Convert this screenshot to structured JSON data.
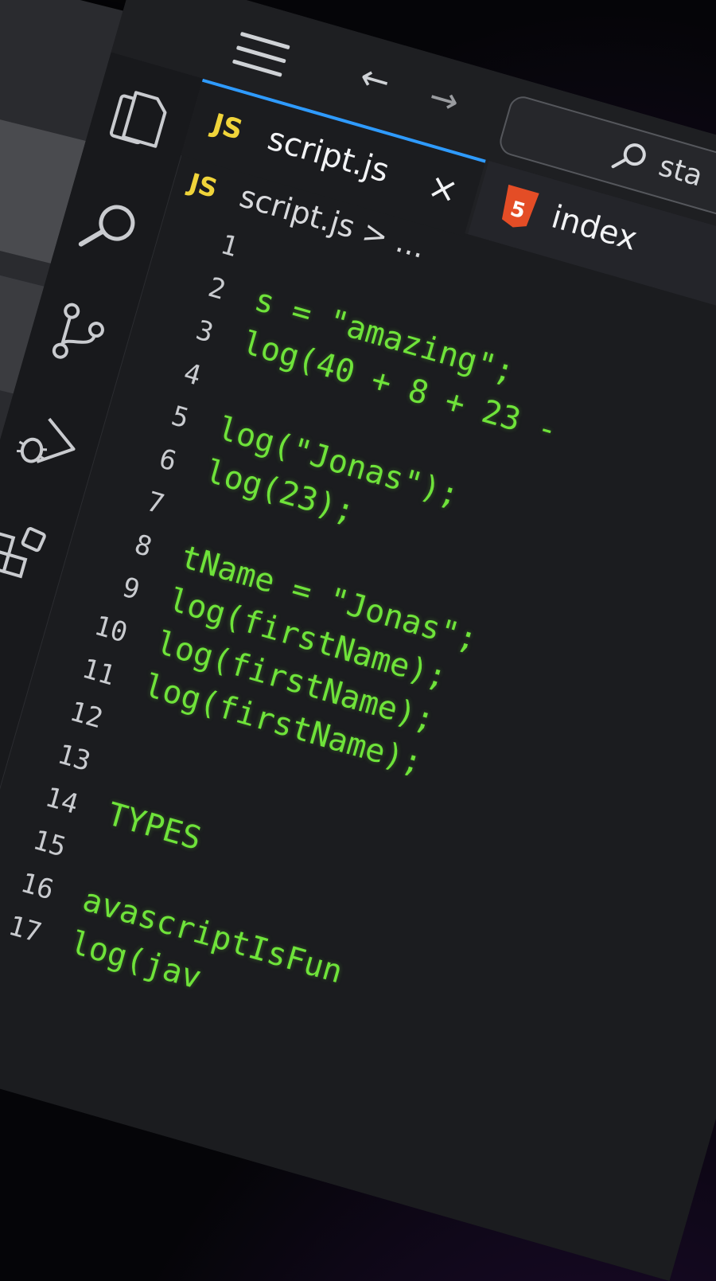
{
  "titlebar": {
    "back_arrow": "←",
    "forward_arrow": "→",
    "search_text": "sta"
  },
  "tabs": [
    {
      "icon": "JS",
      "label": "script.js",
      "close": "×"
    },
    {
      "icon": "html5-icon",
      "label": "index"
    }
  ],
  "breadcrumb": {
    "icon": "JS",
    "path": "script.js > ..."
  },
  "activity_bar": [
    "files-icon",
    "search-icon",
    "source-control-icon",
    "run-debug-icon",
    "extensions-icon"
  ],
  "code": [
    {
      "n": "1",
      "text": ""
    },
    {
      "n": "2",
      "text": "s = \"amazing\";"
    },
    {
      "n": "3",
      "text": "log(40 + 8 + 23 -"
    },
    {
      "n": "4",
      "text": ""
    },
    {
      "n": "5",
      "text": "log(\"Jonas\");"
    },
    {
      "n": "6",
      "text": "log(23);"
    },
    {
      "n": "7",
      "text": ""
    },
    {
      "n": "8",
      "text": "tName = \"Jonas\";"
    },
    {
      "n": "9",
      "text": "log(firstName);"
    },
    {
      "n": "10",
      "text": "log(firstName);"
    },
    {
      "n": "11",
      "text": "log(firstName);"
    },
    {
      "n": "12",
      "text": ""
    },
    {
      "n": "13",
      "text": ""
    },
    {
      "n": "14",
      "text": "TYPES"
    },
    {
      "n": "15",
      "text": ""
    },
    {
      "n": "16",
      "text": "avascriptIsFun"
    },
    {
      "n": "17",
      "text": "log(jav"
    }
  ],
  "colors": {
    "code": "#6fe33a",
    "tab_accent": "#2f9bff",
    "js_badge": "#f0d43a",
    "html5": "#e44d26"
  }
}
